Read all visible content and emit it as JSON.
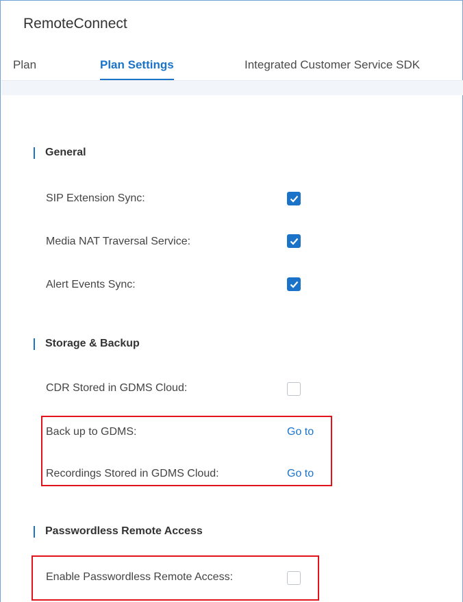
{
  "app": {
    "title": "RemoteConnect"
  },
  "tabs": [
    {
      "label": "Plan",
      "active": false
    },
    {
      "label": "Plan Settings",
      "active": true
    },
    {
      "label": "Integrated Customer Service SDK",
      "active": false
    }
  ],
  "sections": {
    "general": {
      "title": "General",
      "rows": [
        {
          "label": "SIP Extension Sync:",
          "checked": true
        },
        {
          "label": "Media NAT Traversal Service:",
          "checked": true
        },
        {
          "label": "Alert Events Sync:",
          "checked": true
        }
      ]
    },
    "storage": {
      "title": "Storage & Backup",
      "cdr": {
        "label": "CDR Stored in GDMS Cloud:",
        "checked": false
      },
      "backup": {
        "label": "Back up to GDMS:",
        "link": "Go to"
      },
      "recordings": {
        "label": "Recordings Stored in GDMS Cloud:",
        "link": "Go to"
      }
    },
    "passwordless": {
      "title": "Passwordless Remote Access",
      "enable": {
        "label": "Enable Passwordless Remote Access:",
        "checked": false
      }
    }
  },
  "colors": {
    "accent": "#1a73c9",
    "highlight": "#e0131a",
    "band": "#f2f5f9"
  }
}
